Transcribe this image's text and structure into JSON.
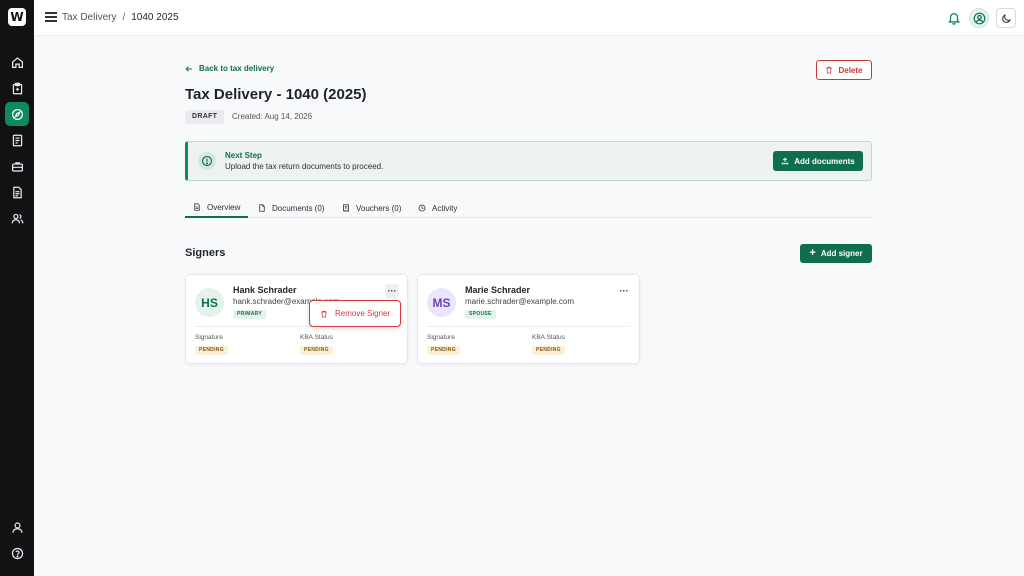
{
  "app": {
    "logo_letter": "W"
  },
  "sidebar": {
    "items": [
      {
        "name": "home-icon"
      },
      {
        "name": "clipboard-icon"
      },
      {
        "name": "compass-icon",
        "active": true
      },
      {
        "name": "document-list-icon"
      },
      {
        "name": "briefcase-icon"
      },
      {
        "name": "file-text-icon"
      },
      {
        "name": "users-icon"
      }
    ],
    "bottom": [
      {
        "name": "user-icon"
      },
      {
        "name": "help-icon"
      }
    ]
  },
  "header": {
    "breadcrumb": [
      "Tax Delivery",
      "1040 2025"
    ],
    "separator": "/"
  },
  "page": {
    "back_label": "Back to tax delivery",
    "delete_label": "Delete",
    "title": "Tax Delivery - 1040 (2025)",
    "status_badge": "DRAFT",
    "created": "Created: Aug 14, 2026"
  },
  "next_step": {
    "title": "Next Step",
    "description": "Upload the tax return documents to proceed.",
    "button_label": "Add documents"
  },
  "tabs": [
    {
      "label": "Overview",
      "active": true
    },
    {
      "label": "Documents (0)"
    },
    {
      "label": "Vouchers (0)"
    },
    {
      "label": "Activity"
    }
  ],
  "signers": {
    "title": "Signers",
    "add_label": "Add signer",
    "cards": [
      {
        "initials": "HS",
        "name": "Hank Schrader",
        "email": "hank.schrader@example.com",
        "role": "PRIMARY",
        "signature_label": "Signature",
        "signature_status": "PENDING",
        "kba_label": "KBA Status",
        "kba_status": "PENDING"
      },
      {
        "initials": "MS",
        "name": "Marie Schrader",
        "email": "marie.schrader@example.com",
        "role": "SPOUSE",
        "signature_label": "Signature",
        "signature_status": "PENDING",
        "kba_label": "KBA Status",
        "kba_status": "PENDING"
      }
    ],
    "more_label": "···",
    "menu": {
      "remove_label": "Remove Signer"
    }
  },
  "colors": {
    "accent": "#0f6f4d",
    "danger": "#c63a3a",
    "sidebar": "#111214",
    "pending_bg": "#fdf0d9"
  }
}
